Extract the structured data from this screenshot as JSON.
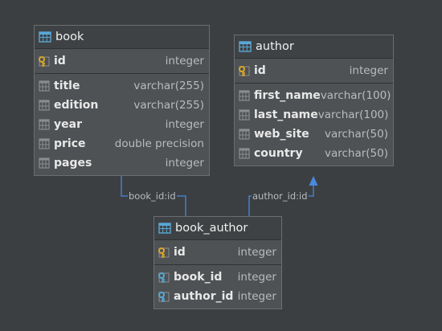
{
  "tables": {
    "book": {
      "title": "book",
      "key_columns": [
        {
          "name": "id",
          "type": "integer",
          "icon": "primary-key-icon"
        }
      ],
      "columns": [
        {
          "name": "title",
          "type": "varchar(255)"
        },
        {
          "name": "edition",
          "type": "varchar(255)"
        },
        {
          "name": "year",
          "type": "integer"
        },
        {
          "name": "price",
          "type": "double precision"
        },
        {
          "name": "pages",
          "type": "integer"
        }
      ]
    },
    "author": {
      "title": "author",
      "key_columns": [
        {
          "name": "id",
          "type": "integer",
          "icon": "primary-key-icon"
        }
      ],
      "columns": [
        {
          "name": "first_name",
          "type": "varchar(100)"
        },
        {
          "name": "last_name",
          "type": "varchar(100)"
        },
        {
          "name": "web_site",
          "type": "varchar(50)"
        },
        {
          "name": "country",
          "type": "varchar(50)"
        }
      ]
    },
    "book_author": {
      "title": "book_author",
      "key_columns": [
        {
          "name": "id",
          "type": "integer",
          "icon": "primary-key-icon"
        }
      ],
      "columns": [
        {
          "name": "book_id",
          "type": "integer",
          "icon": "foreign-key-icon"
        },
        {
          "name": "author_id",
          "type": "integer",
          "icon": "foreign-key-icon"
        }
      ]
    }
  },
  "relations": [
    {
      "label": "book_id:id",
      "from": "book_author",
      "to": "book"
    },
    {
      "label": "author_id:id",
      "from": "book_author",
      "to": "author"
    }
  ],
  "colors": {
    "background": "#3c3f41",
    "arrow": "#4a88e0",
    "table_icon": "#5aa7d6",
    "key": "#d9a72a",
    "column_icon": "#8a8d8f"
  }
}
